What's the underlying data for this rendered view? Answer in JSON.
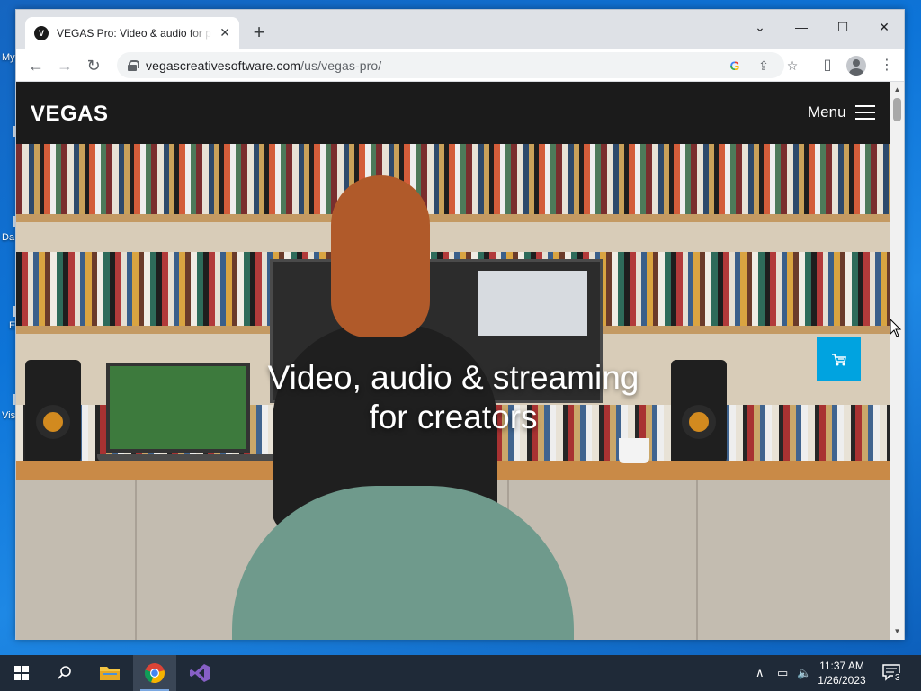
{
  "desktop": {
    "icon_labels": [
      "My",
      "Da",
      "E",
      "Vis"
    ]
  },
  "browser": {
    "tab": {
      "favicon_letter": "V",
      "title": "VEGAS Pro: Video & audio for pr"
    },
    "new_tab_label": "+",
    "window_controls": {
      "tab_search": "⌄",
      "minimize": "—",
      "maximize": "☐",
      "close": "✕"
    },
    "url": {
      "host": "vegascreativesoftware.com",
      "path": "/us/vegas-pro/"
    }
  },
  "site": {
    "logo": "VEGAS",
    "menu_label": "Menu",
    "hero": {
      "headline_line1": "Video, audio & streaming",
      "headline_line2": "for creators"
    },
    "accent_color": "#00a3e0",
    "header_color": "#1b1b1b"
  },
  "taskbar": {
    "time": "11:37 AM",
    "date": "1/26/2023",
    "notification_count": "3",
    "pinned": [
      "file-explorer",
      "chrome",
      "visual-studio"
    ]
  }
}
